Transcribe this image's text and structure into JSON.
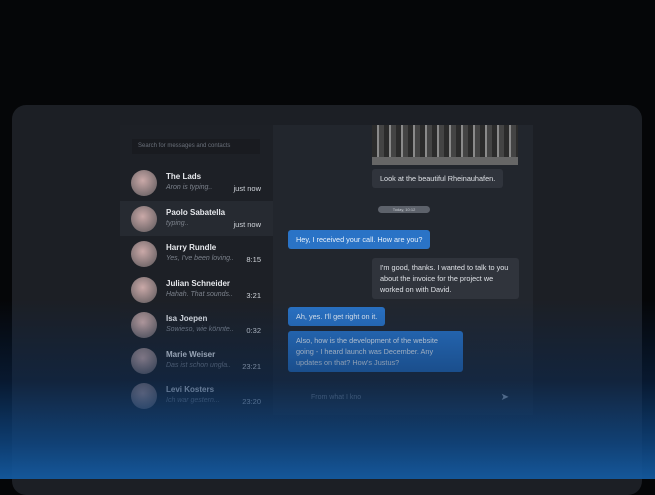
{
  "search": {
    "placeholder": "Search for messages and contacts"
  },
  "conversations": [
    {
      "name": "The Lads",
      "preview": "Aron is typing..",
      "time": "just now"
    },
    {
      "name": "Paolo Sabatella",
      "preview": "typing..",
      "time": "just now"
    },
    {
      "name": "Harry Rundle",
      "preview": "Yes, I've been loving..",
      "time": "8:15"
    },
    {
      "name": "Julian Schneider",
      "preview": "Hahah. That sounds..",
      "time": "3:21"
    },
    {
      "name": "Isa Joepen",
      "preview": "Sowieso, wie könnte..",
      "time": "0:32"
    },
    {
      "name": "Marie Weiser",
      "preview": "Das ist schon ungla..",
      "time": "23:21"
    },
    {
      "name": "Levi Kosters",
      "preview": "Ich war gestern...",
      "time": "23:20"
    }
  ],
  "chat": {
    "image_caption": "Look at the beautiful Rheinauhafen.",
    "date_divider": "Today, 10:12",
    "messages": [
      {
        "dir": "out",
        "text": "Hey, I received your call. How are you?"
      },
      {
        "dir": "in",
        "text": "I'm good, thanks. I wanted to talk to you about the invoice for the project we worked on with David."
      },
      {
        "dir": "out",
        "text": "Ah, yes. I'll get right on it."
      },
      {
        "dir": "out",
        "text": "Also, how is the development of the website going - I heard launch was December. Any updates on that? How's Justus?"
      }
    ],
    "input_value": "From what I kno"
  }
}
